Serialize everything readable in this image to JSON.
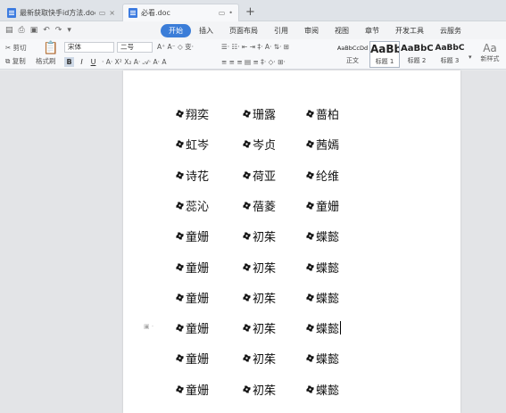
{
  "tabs": [
    {
      "title": "最新获取快手id方法.doc",
      "active": false
    },
    {
      "title": "必看.doc",
      "active": true
    }
  ],
  "menu": [
    "开始",
    "插入",
    "页面布局",
    "引用",
    "审阅",
    "视图",
    "章节",
    "开发工具",
    "云服务"
  ],
  "ribbon": {
    "cut_label": "剪切",
    "paste_label": "粘贴",
    "copy_label": "复制",
    "format_painter_label": "格式刷",
    "font_name": "宋体",
    "font_size": "二号",
    "styles": [
      {
        "preview": "AaBbCcDd",
        "name": "正文"
      },
      {
        "preview": "AaBb",
        "name": "标题 1"
      },
      {
        "preview": "AaBbC",
        "name": "标题 2"
      },
      {
        "preview": "AaBbC",
        "name": "标题 3"
      }
    ],
    "new_style_label": "新样式"
  },
  "document": {
    "rows": [
      [
        "翔奕",
        "珊露",
        "蔷柏"
      ],
      [
        "虹岑",
        "岑贞",
        "茜嫣"
      ],
      [
        "诗花",
        "荷亚",
        "纶维"
      ],
      [
        "蕊沁",
        "蓓菱",
        "童姗"
      ],
      [
        "童姗",
        "初茱",
        "蝶懿"
      ],
      [
        "童姗",
        "初茱",
        "蝶懿"
      ],
      [
        "童姗",
        "初茱",
        "蝶懿"
      ],
      [
        "童姗",
        "初茱",
        "蝶懿"
      ],
      [
        "童姗",
        "初茱",
        "蝶懿"
      ],
      [
        "童姗",
        "初茱",
        "蝶懿"
      ]
    ]
  }
}
